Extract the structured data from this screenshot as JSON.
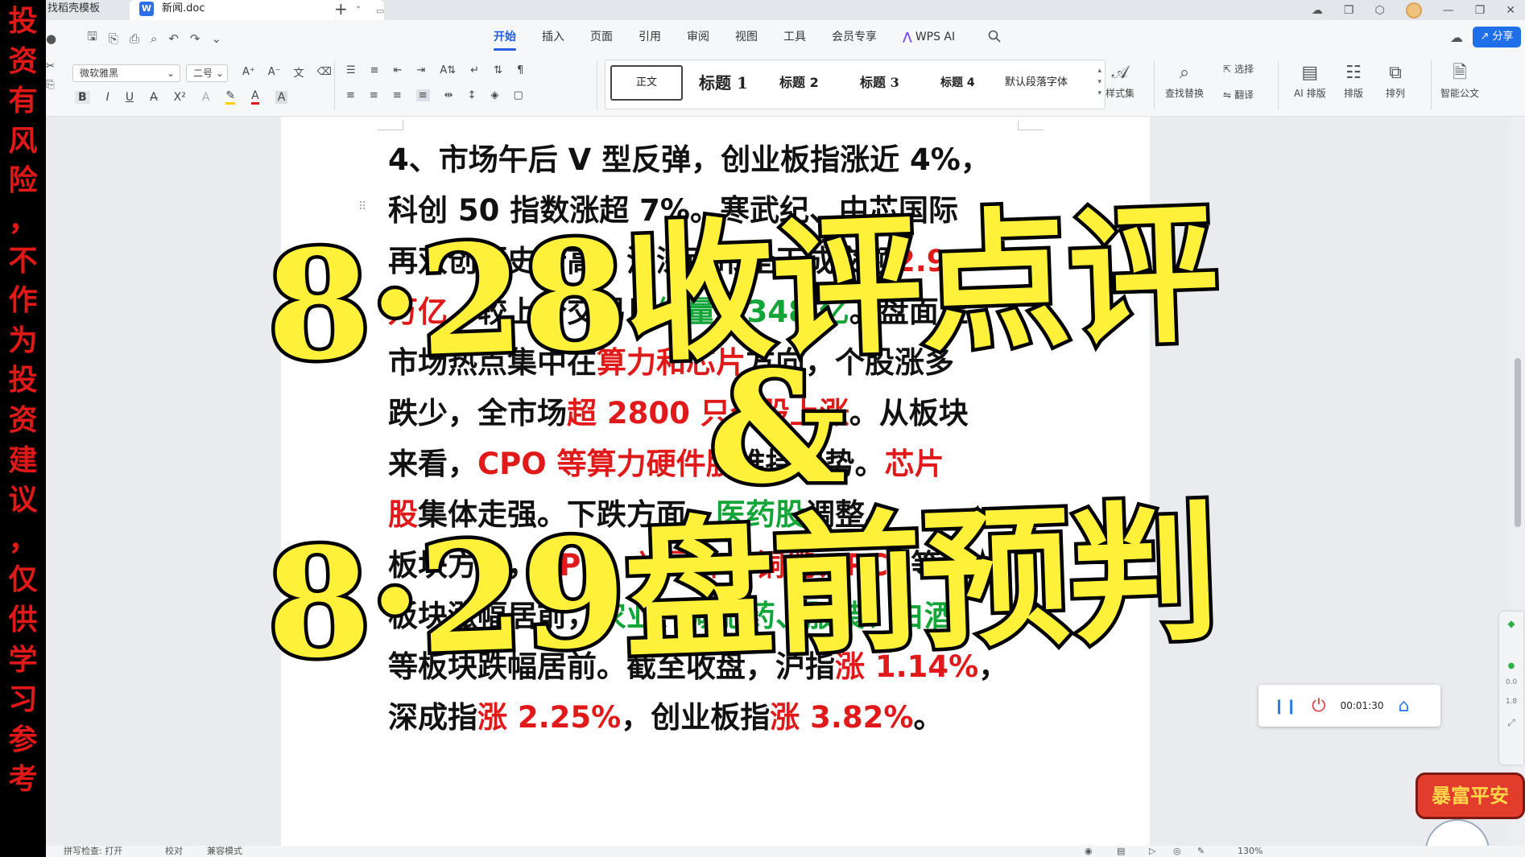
{
  "disclaimer": "投资有风险，不作为投资建议，仅供学习参考",
  "tabs": {
    "template_tab": "找稻壳模板",
    "doc_logo": "W",
    "doc_tab": "新闻.doc"
  },
  "menu": {
    "items": [
      "开始",
      "插入",
      "页面",
      "引用",
      "审阅",
      "视图",
      "工具",
      "会员专享"
    ],
    "ai_label": "WPS AI",
    "share": "分享"
  },
  "ribbon": {
    "font_name": "微软雅黑",
    "font_size": "二号",
    "styles": {
      "normal": "正文",
      "h1": "标题 1",
      "h2": "标题 2",
      "h3": "标题 3",
      "h4": "标题 4",
      "default_para_font": "默认段落字体"
    },
    "style_set": "样式集",
    "find_replace": "查找替换",
    "select": "选择",
    "translate": "翻译",
    "ai_layout": "AI 排版",
    "layout": "排版",
    "arrange": "排列",
    "smart_doc": "智能公文"
  },
  "document": {
    "lines": [
      [
        {
          "t": "4、市场午后 V 型反弹，创业板指涨近 4%，",
          "c": ""
        }
      ],
      [
        {
          "t": "科创 50 指数涨超 7%。寒武纪、中芯国际",
          "c": ""
        }
      ],
      [
        {
          "t": "再双创历史新高。沪深两市全天成交额",
          "c": ""
        },
        {
          "t": "2.97",
          "c": "r"
        }
      ],
      [
        {
          "t": "万亿",
          "c": "r"
        },
        {
          "t": "，较上个交易日",
          "c": ""
        },
        {
          "t": "缩量 1348 亿",
          "c": "g"
        },
        {
          "t": "。盘面上，",
          "c": ""
        }
      ],
      [
        {
          "t": "市场热点集中在",
          "c": ""
        },
        {
          "t": "算力和芯片",
          "c": "r"
        },
        {
          "t": "方向，个股涨多",
          "c": ""
        }
      ],
      [
        {
          "t": "跌少，全市场",
          "c": ""
        },
        {
          "t": "超 2800 只个股上涨",
          "c": "r"
        },
        {
          "t": "。从板块",
          "c": ""
        }
      ],
      [
        {
          "t": "来看，",
          "c": ""
        },
        {
          "t": "CPO 等算力硬件股",
          "c": "r"
        },
        {
          "t": "维持强势。",
          "c": ""
        },
        {
          "t": "芯片",
          "c": "r"
        }
      ],
      [
        {
          "t": "股",
          "c": "r"
        },
        {
          "t": "集体走强。下跌方面，",
          "c": ""
        },
        {
          "t": "医药股",
          "c": "g"
        },
        {
          "t": "调整。",
          "c": ""
        }
      ],
      [
        {
          "t": "板块方面，",
          "c": ""
        },
        {
          "t": "CPO、半导体、铜缆、PCB",
          "c": "r"
        },
        {
          "t": "等",
          "c": ""
        }
      ],
      [
        {
          "t": "板块涨幅居前，",
          "c": ""
        },
        {
          "t": "农业、减肥药、服装、白酒",
          "c": "g"
        }
      ],
      [
        {
          "t": "等板块跌幅居前。截至收盘，沪指",
          "c": ""
        },
        {
          "t": "涨 1.14%",
          "c": "r"
        },
        {
          "t": "，",
          "c": ""
        }
      ],
      [
        {
          "t": "深成指",
          "c": ""
        },
        {
          "t": "涨 2.25%",
          "c": "r"
        },
        {
          "t": "，创业板指",
          "c": ""
        },
        {
          "t": "涨 3.82%",
          "c": "r"
        },
        {
          "t": "。",
          "c": ""
        }
      ]
    ]
  },
  "overlay": {
    "line1": "8·28收评点评",
    "line2": "&",
    "line3": "8·29盘前预判"
  },
  "recorder": {
    "time": "00:01:30"
  },
  "side_widget": {
    "v1": "0.0",
    "v2": "1.8"
  },
  "badge": "暴富平安",
  "statusbar": {
    "spellcheck": "拼写检查: 打开",
    "proof": "校对",
    "compat": "兼容模式",
    "zoom": "130%"
  },
  "colors": {
    "accent": "#1f5fe0",
    "red_text": "#e01a1a",
    "green_text": "#13a538",
    "caption_fill": "#fff03a"
  }
}
